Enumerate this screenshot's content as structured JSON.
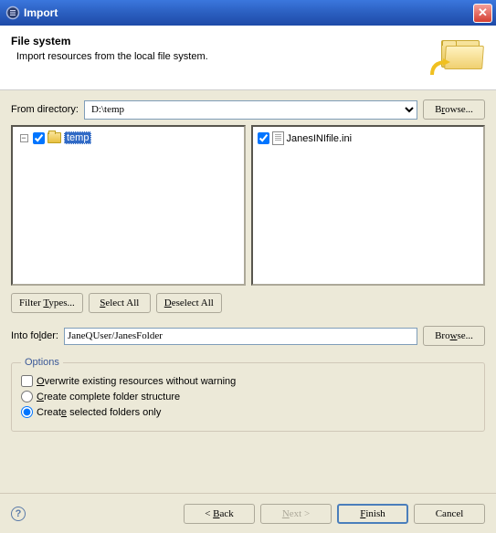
{
  "title": "Import",
  "header": {
    "heading": "File system",
    "sub": "Import resources from the local file system."
  },
  "fromDir": {
    "label": "From directory:",
    "value": "D:\\temp",
    "browse": "Browse..."
  },
  "tree": {
    "item": "temp"
  },
  "files": {
    "item": "JanesINIfile.ini"
  },
  "buttons": {
    "filter": "Filter Types...",
    "selectAll": "Select All",
    "deselectAll": "Deselect All"
  },
  "intoFolder": {
    "label": "Into folder:",
    "value": "JaneQUser/JanesFolder",
    "browse": "Browse..."
  },
  "options": {
    "legend": "Options",
    "overwrite": "Overwrite existing resources without warning",
    "complete": "Create complete folder structure",
    "selected": "Create selected folders only"
  },
  "footer": {
    "back": "< Back",
    "next": "Next >",
    "finish": "Finish",
    "cancel": "Cancel"
  }
}
